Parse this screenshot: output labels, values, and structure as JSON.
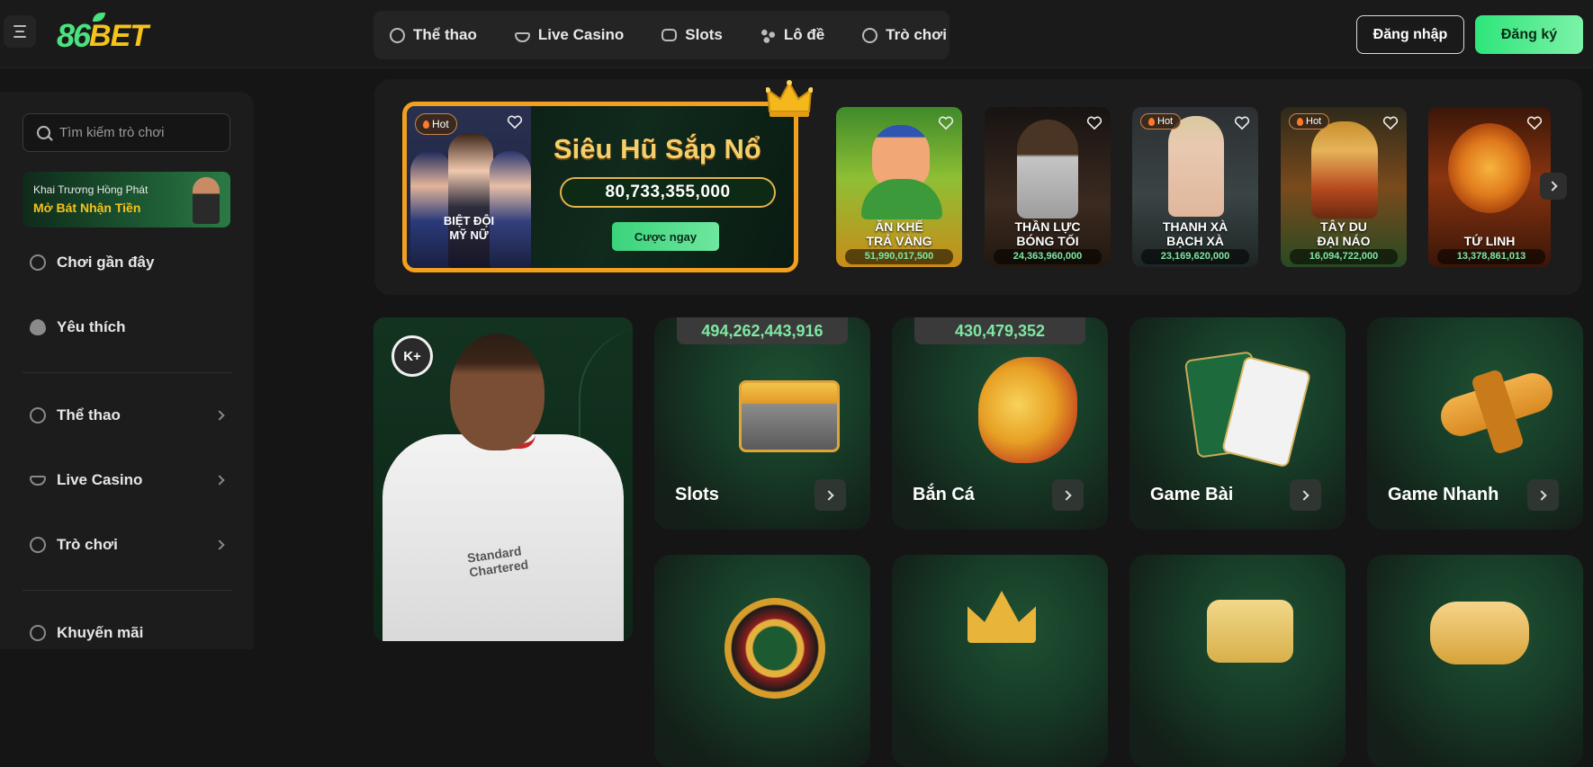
{
  "header": {
    "logo_number": "86",
    "logo_text": "BET",
    "nav": [
      {
        "label": "Thể thao",
        "icon": "soccer-ball-icon"
      },
      {
        "label": "Live Casino",
        "icon": "dealer-bowl-icon"
      },
      {
        "label": "Slots",
        "icon": "slot-machine-icon"
      },
      {
        "label": "Lô đề",
        "icon": "lottery-balls-icon"
      },
      {
        "label": "Trò chơi",
        "icon": "game-chip-icon"
      }
    ],
    "login_label": "Đăng nhập",
    "register_label": "Đăng ký"
  },
  "sidebar": {
    "search_placeholder": "Tìm kiếm trò chơi",
    "promo_line1": "Khai Trương Hồng Phát",
    "promo_line2": "Mở Bát Nhận Tiền",
    "items": [
      {
        "label": "Chơi gần đây",
        "icon": "clock-icon"
      },
      {
        "label": "Yêu thích",
        "icon": "heart-icon"
      },
      {
        "label": "Thể thao",
        "icon": "soccer-ball-icon"
      },
      {
        "label": "Live Casino",
        "icon": "dealer-bowl-icon"
      },
      {
        "label": "Trò chơi",
        "icon": "game-chip-icon"
      },
      {
        "label": "Khuyến mãi",
        "icon": "gift-icon"
      }
    ]
  },
  "jackpot": {
    "hot_label": "Hot",
    "featured_game": "BIỆT ĐỘI\nMỸ NỮ",
    "title": "Siêu Hũ Sắp Nổ",
    "amount": "80,733,355,000",
    "cta_label": "Cược ngay"
  },
  "games": [
    {
      "name": "ĂN KHẾ\nTRẢ VÀNG",
      "jackpot": "51,990,017,500",
      "hot": false
    },
    {
      "name": "THẦN LỰC\nBÓNG TỐI",
      "jackpot": "24,363,960,000",
      "hot": false
    },
    {
      "name": "THANH XÀ\nBẠCH XÀ",
      "jackpot": "23,169,620,000",
      "hot": true
    },
    {
      "name": "TÂY DU\nĐẠI NÁO",
      "jackpot": "16,094,722,000",
      "hot": true
    },
    {
      "name": "TỨ LINH",
      "jackpot": "13,378,861,013",
      "hot": false
    }
  ],
  "hot_badge": "Hot",
  "sport_badge": "K+",
  "sponsor_text": "Standard\nChartered",
  "categories": [
    {
      "label": "Slots",
      "jackpot": "494,262,443,916"
    },
    {
      "label": "Bắn Cá",
      "jackpot": "430,479,352"
    },
    {
      "label": "Game Bài",
      "jackpot": ""
    },
    {
      "label": "Game Nhanh",
      "jackpot": ""
    }
  ],
  "colors": {
    "accent_green": "#3ad37b",
    "gold": "#f2a01e",
    "background": "#151515"
  }
}
